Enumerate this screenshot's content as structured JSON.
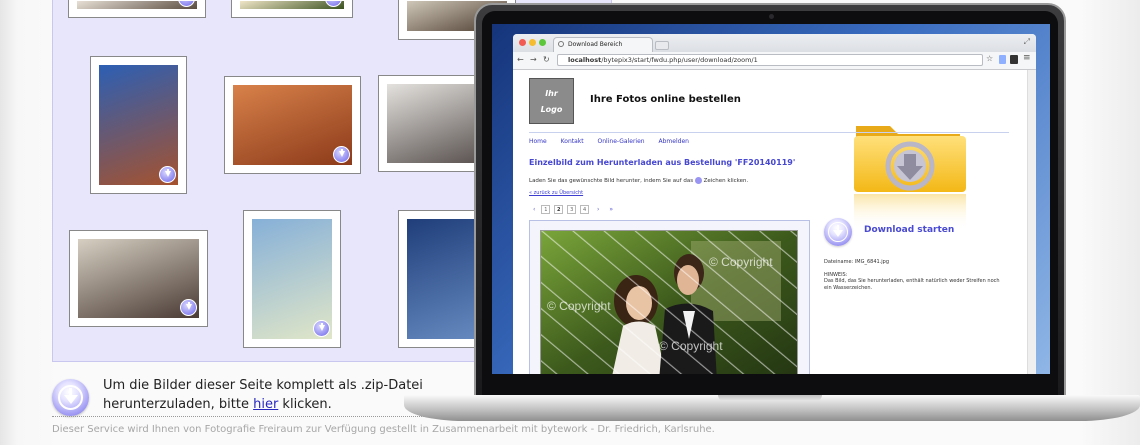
{
  "gallery": {
    "thumbnails": [
      {
        "name": "photo-top-1",
        "palette": [
          "#e8e0d6",
          "#5a4c40"
        ]
      },
      {
        "name": "photo-top-2",
        "palette": [
          "#f0e6c8",
          "#3b5220"
        ]
      },
      {
        "name": "photo-top-3",
        "palette": [
          "#cfc7b9",
          "#4c3c2e"
        ]
      },
      {
        "name": "photo-bride-cans",
        "palette": [
          "#2c5fb4",
          "#a5522e"
        ]
      },
      {
        "name": "photo-banquet",
        "palette": [
          "#d8814a",
          "#8c3a1a"
        ]
      },
      {
        "name": "photo-friends",
        "palette": [
          "#e4e2de",
          "#504846"
        ]
      },
      {
        "name": "photo-cake",
        "palette": [
          "#d6cfc2",
          "#4a3b34"
        ]
      },
      {
        "name": "photo-garden-fence",
        "palette": [
          "#86b0d8",
          "#e0e6c8"
        ]
      },
      {
        "name": "photo-bride-sky",
        "palette": [
          "#1f3e7a",
          "#6a8ec4"
        ]
      }
    ]
  },
  "zip": {
    "line1": "Um die Bilder dieser Seite komplett als .zip-Datei",
    "line2_prefix": "herunterzuladen, bitte ",
    "link": "hier",
    "line2_suffix": " klicken."
  },
  "footer": {
    "text": "Dieser Service wird Ihnen von Fotografie Freiraum zur Verfügung gestellt in Zusammenarbeit mit bytework - Dr. Friedrich, Karlsruhe."
  },
  "browser": {
    "tab_title": "Download Bereich",
    "url_host": "localhost",
    "url_path": "/bytepix3/start/fwdu.php/user/download/zoom/1"
  },
  "site": {
    "logo_line1": "Ihr",
    "logo_line2": "Logo",
    "title": "Ihre Fotos online bestellen",
    "menu": [
      "Home",
      "Kontakt",
      "Online-Galerien",
      "Abmelden"
    ],
    "heading": "Einzelbild zum Herunterladen aus Bestellung 'FF20140119'",
    "intro_prefix": "Laden Sie das gewünschte Bild herunter, indem Sie auf das",
    "intro_suffix": "Zeichen klicken.",
    "back_link": "« zurück zu Übersicht",
    "pages": [
      "1",
      "2",
      "3",
      "4"
    ],
    "active_page": "2",
    "pager_prev": "‹",
    "pager_next": "›",
    "pager_last": "»",
    "watermark": "© Copyright",
    "download_label": "Download starten",
    "filename_label": "Dateiname: IMG_6841.jpg",
    "hint_title": "HINWEIS:",
    "hint_text": "Das Bild, das Sie herunterladen, enthält natürlich weder Streifen noch ein Wasserzeichen."
  },
  "colors": {
    "accent": "#4a4ad2",
    "gallery_bg": "#e8e6fb",
    "folder": "#f7c73a"
  }
}
